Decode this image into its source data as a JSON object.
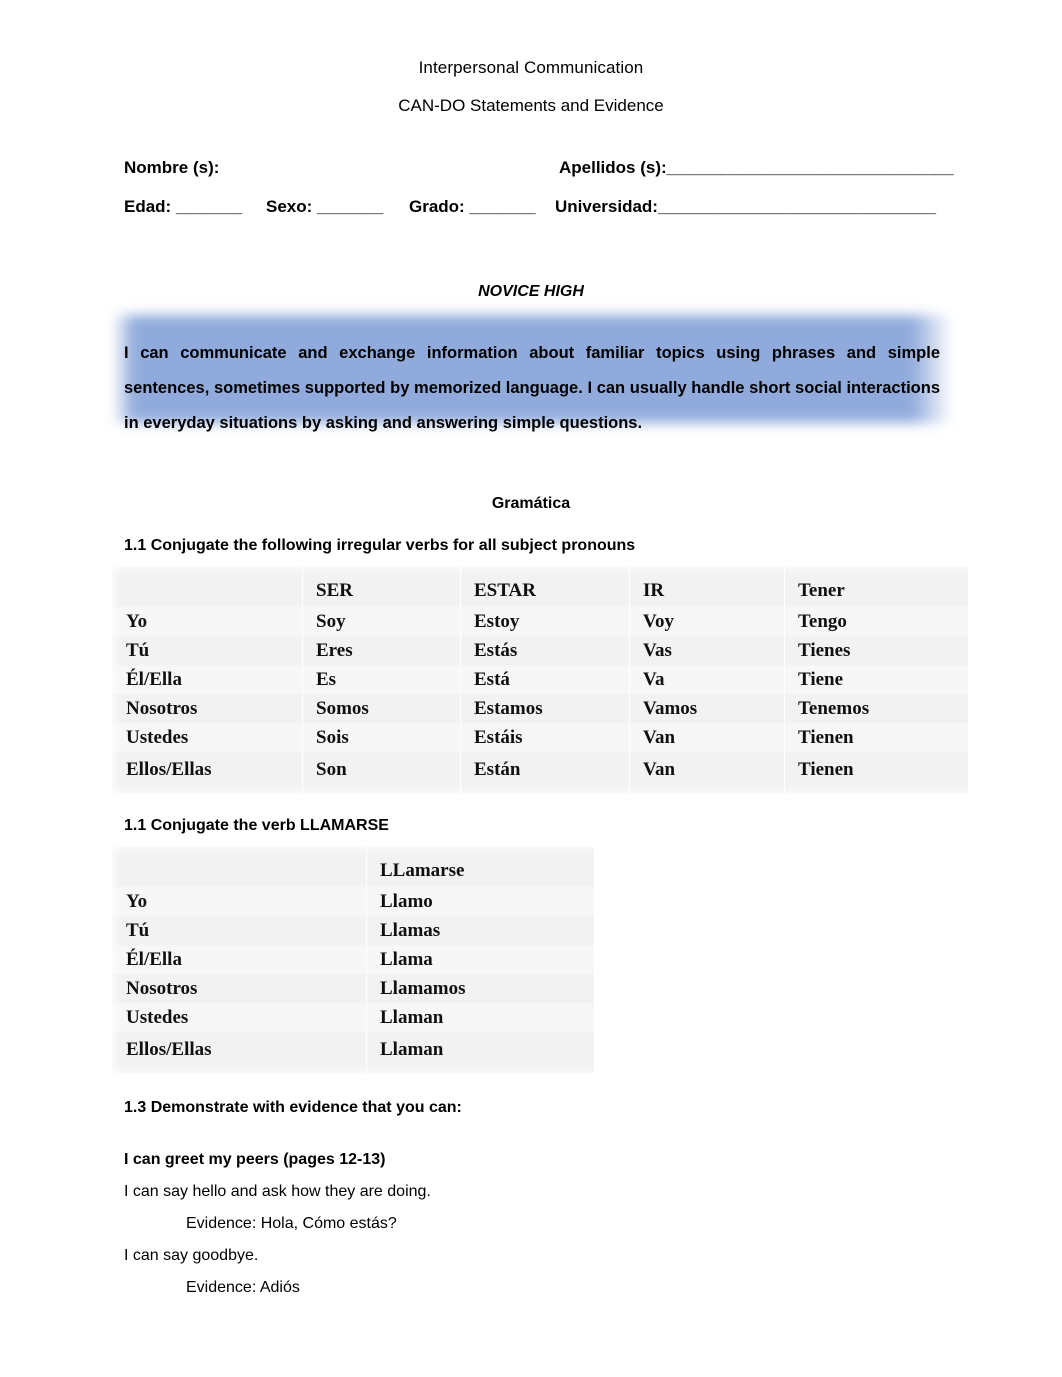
{
  "header": {
    "title": "Interpersonal Communication",
    "subtitle": "CAN-DO Statements and Evidence"
  },
  "identity_fields": {
    "nombre_label": "Nombre (s):",
    "apellidos_label": "Apellidos (s):",
    "apellidos_rule": "________________________________",
    "edad_label": "Edad: _______",
    "sexo_label": "Sexo: _______",
    "grado_label": "Grado: _______",
    "universidad_label": "Universidad:",
    "universidad_rule": "_______________________________"
  },
  "level": {
    "heading": "NOVICE HIGH",
    "statement": "I can communicate and exchange information about familiar topics using phrases and simple sentences, sometimes supported by memorized language. I can usually handle short social interactions in everyday situations by asking and answering simple questions.",
    "highlight_color": "#8BA7DA"
  },
  "grammar": {
    "section_title": "Gramática",
    "subsection_1_1_verbs": "1.1 Conjugate the following irregular verbs for all subject pronouns",
    "subsection_1_1_llamarse": "1.1 Conjugate the verb LLAMARSE",
    "verbs_table": {
      "columns": [
        "",
        "SER",
        "ESTAR",
        "IR",
        "Tener"
      ],
      "rows": [
        [
          "",
          "SER",
          "ESTAR",
          "IR",
          "Tener"
        ],
        [
          "Yo",
          "Soy",
          "Estoy",
          "Voy",
          "Tengo"
        ],
        [
          "Tú",
          "Eres",
          "Estás",
          "Vas",
          "Tienes"
        ],
        [
          "Él/Ella",
          "Es",
          "Está",
          "Va",
          "Tiene"
        ],
        [
          "Nosotros",
          "Somos",
          "Estamos",
          "Vamos",
          "Tenemos"
        ],
        [
          "Ustedes",
          "Sois",
          "Estáis",
          "Van",
          "Tienen"
        ],
        [
          "Ellos/Ellas",
          "Son",
          "Están",
          "Van",
          "Tienen"
        ]
      ]
    },
    "llamarse_table": {
      "columns": [
        "",
        "LLamarse"
      ],
      "rows": [
        [
          "",
          "LLamarse"
        ],
        [
          "Yo",
          "Llamo"
        ],
        [
          "Tú",
          "Llamas"
        ],
        [
          "Él/Ella",
          "Llama"
        ],
        [
          "Nosotros",
          "Llamamos"
        ],
        [
          "Ustedes",
          "Llaman"
        ],
        [
          "Ellos/Ellas",
          "Llaman"
        ]
      ]
    }
  },
  "evidence": {
    "demonstrate_heading": "1.3 Demonstrate with evidence that you can:",
    "cando_heading": "I can greet my peers (pages 12-13)",
    "items": [
      {
        "statement": "I can say hello and ask how they are doing.",
        "evidence": "Evidence: Hola, Cómo estás?"
      },
      {
        "statement": "I can say goodbye.",
        "evidence": "Evidence: Adiós"
      }
    ]
  }
}
